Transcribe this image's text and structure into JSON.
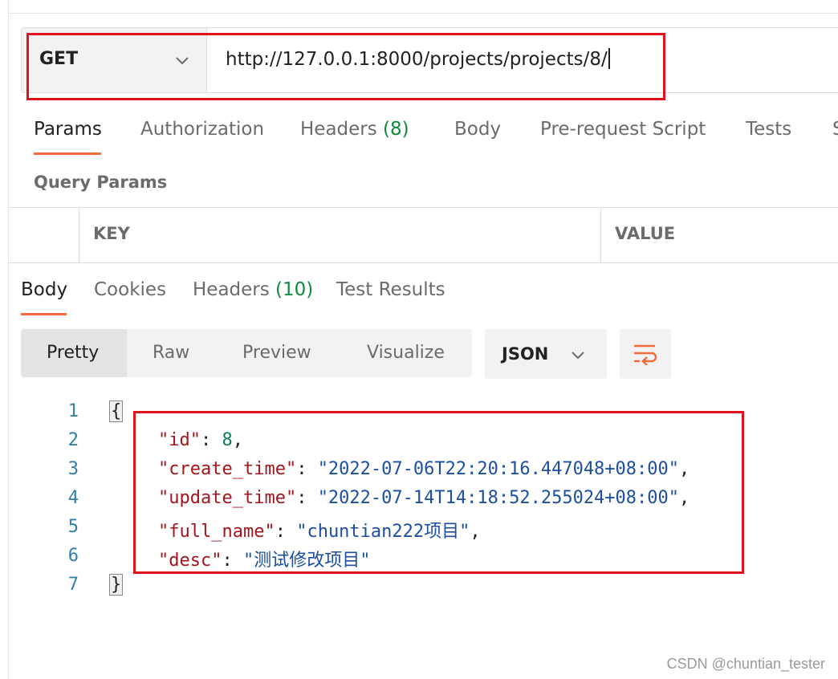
{
  "request": {
    "method": "GET",
    "url": "http://127.0.0.1:8000/projects/projects/8/"
  },
  "request_tabs": [
    {
      "label": "Params",
      "count": ""
    },
    {
      "label": "Authorization",
      "count": ""
    },
    {
      "label": "Headers",
      "count": "(8)"
    },
    {
      "label": "Body",
      "count": ""
    },
    {
      "label": "Pre-request Script",
      "count": ""
    },
    {
      "label": "Tests",
      "count": ""
    },
    {
      "label": "S",
      "count": ""
    }
  ],
  "query_params": {
    "title": "Query Params",
    "columns": [
      "KEY",
      "VALUE"
    ]
  },
  "response_tabs": [
    {
      "label": "Body",
      "count": ""
    },
    {
      "label": "Cookies",
      "count": ""
    },
    {
      "label": "Headers",
      "count": "(10)"
    },
    {
      "label": "Test Results",
      "count": ""
    }
  ],
  "view_modes": [
    "Pretty",
    "Raw",
    "Preview",
    "Visualize"
  ],
  "format": "JSON",
  "icons": {
    "method_dropdown": "chevron-down-icon",
    "format_dropdown": "chevron-down-icon",
    "wrap": "wrap-lines-icon"
  },
  "colors": {
    "accent": "#f26b3a",
    "highlight": "#e0131a",
    "count": "#0f8a3c"
  },
  "response_lines": {
    "numbers": [
      "1",
      "2",
      "3",
      "4",
      "5",
      "6",
      "7"
    ],
    "open_brace": "{",
    "close_brace": "}",
    "fields": [
      {
        "key": "\"id\"",
        "value": "8",
        "type": "number",
        "trail": ","
      },
      {
        "key": "\"create_time\"",
        "value": "\"2022-07-06T22:20:16.447048+08:00\"",
        "type": "string",
        "trail": ","
      },
      {
        "key": "\"update_time\"",
        "value": "\"2022-07-14T14:18:52.255024+08:00\"",
        "type": "string",
        "trail": ","
      },
      {
        "key": "\"full_name\"",
        "value": "\"chuntian222项目\"",
        "type": "string",
        "trail": ","
      },
      {
        "key": "\"desc\"",
        "value": "\"测试修改项目\"",
        "type": "string",
        "trail": ""
      }
    ]
  },
  "watermark": "CSDN @chuntian_tester"
}
